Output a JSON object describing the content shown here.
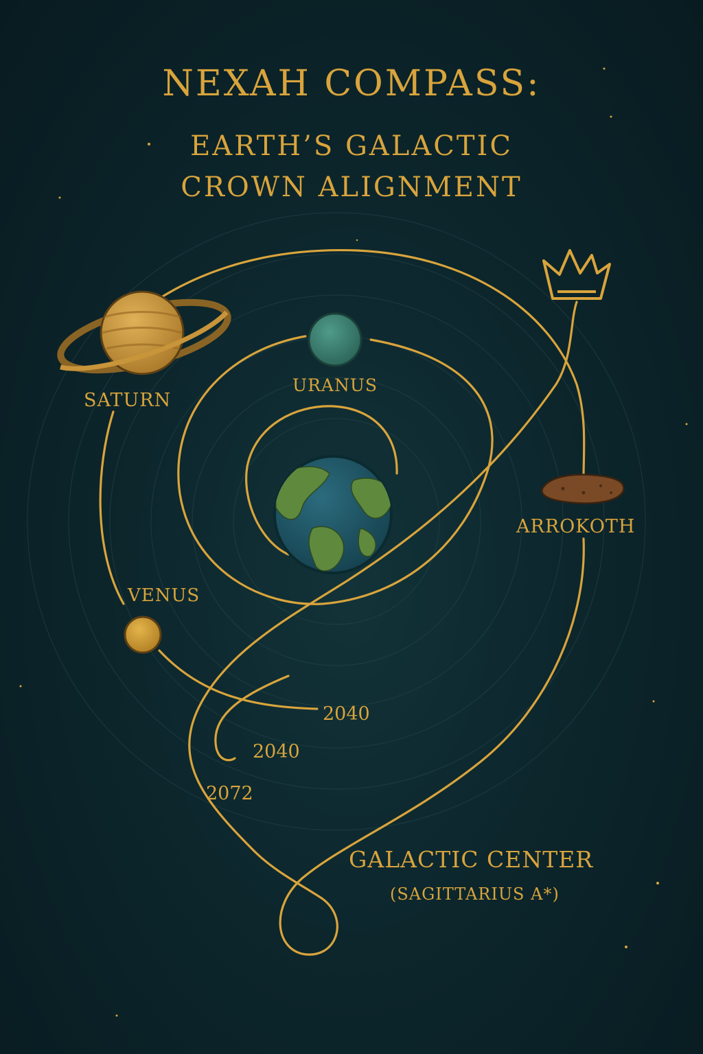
{
  "title": {
    "main": "NEXAH COMPASS:",
    "line2": "EARTH’S GALACTIC",
    "line3": "CROWN ALIGNMENT"
  },
  "labels": {
    "saturn": "SATURN",
    "uranus": "URANUS",
    "venus": "VENUS",
    "arrokoth": "ARROKOTH",
    "year_a": "2040",
    "year_b": "2040",
    "year_c": "2072",
    "center": "GALACTIC CENTER",
    "center_sub": "(SAGITTARIUS A*)"
  },
  "colors": {
    "background": "#0c2329",
    "gold": "#d9a43c",
    "saturn": "#c8953a",
    "uranus": "#3d8575",
    "venus": "#d4a33b",
    "earth_ocean": "#1f5364",
    "earth_land": "#5f8a3e",
    "arrokoth": "#7a4a26"
  }
}
